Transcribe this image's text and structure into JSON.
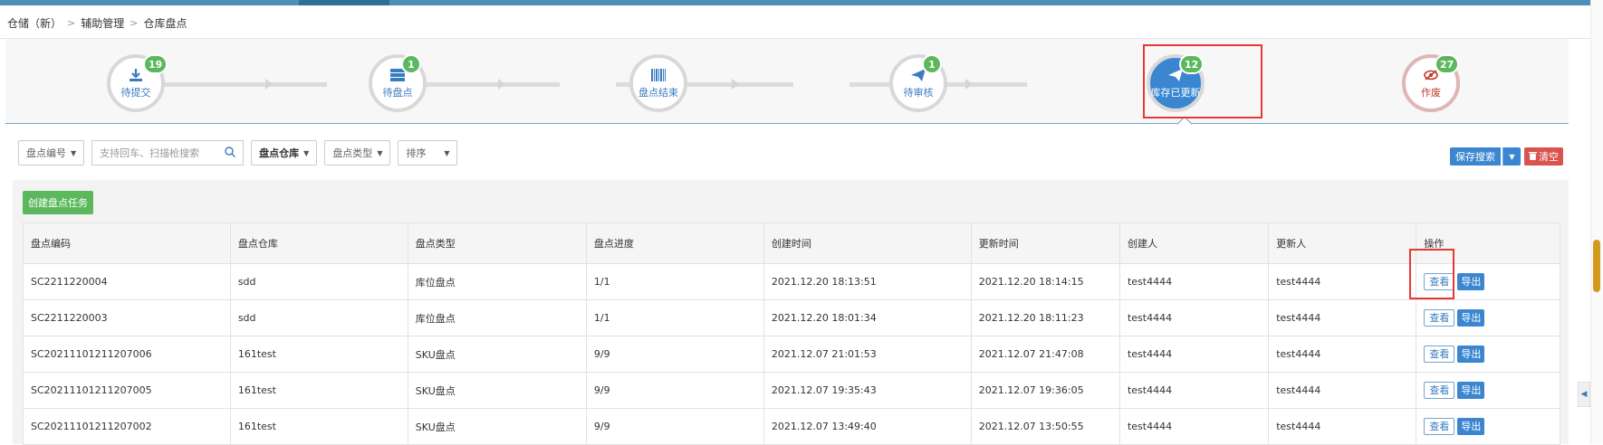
{
  "breadcrumb": [
    "仓储（新）",
    "辅助管理",
    "仓库盘点"
  ],
  "steps": [
    {
      "label": "待提交",
      "count": "19",
      "icon": "download-icon"
    },
    {
      "label": "待盘点",
      "count": "1",
      "icon": "server-icon"
    },
    {
      "label": "盘点结束",
      "count": "",
      "icon": "barcode-icon"
    },
    {
      "label": "待审核",
      "count": "1",
      "icon": "paper-plane-icon"
    },
    {
      "label": "库存已更新",
      "count": "12",
      "icon": "paper-plane-icon",
      "active": true
    },
    {
      "label": "作废",
      "count": "27",
      "icon": "eye-slash-icon"
    }
  ],
  "filters": {
    "code_label": "盘点编号",
    "search_placeholder": "支持回车、扫描枪搜索",
    "warehouse_label": "盘点仓库",
    "type_label": "盘点类型",
    "sort_label": "排序"
  },
  "actions": {
    "save_search": "保存搜索",
    "clear": "清空",
    "create_task": "创建盘点任务"
  },
  "table": {
    "headers": [
      "盘点编码",
      "盘点仓库",
      "盘点类型",
      "盘点进度",
      "创建时间",
      "更新时间",
      "创建人",
      "更新人",
      "操作"
    ],
    "view_label": "查看",
    "export_label": "导出",
    "rows": [
      [
        "SC2211220004",
        "sdd",
        "库位盘点",
        "1/1",
        "2021.12.20 18:13:51",
        "2021.12.20 18:14:15",
        "test4444",
        "test4444"
      ],
      [
        "SC2211220003",
        "sdd",
        "库位盘点",
        "1/1",
        "2021.12.20 18:01:34",
        "2021.12.20 18:11:23",
        "test4444",
        "test4444"
      ],
      [
        "SC20211101211207006",
        "161test",
        "SKU盘点",
        "9/9",
        "2021.12.07 21:01:53",
        "2021.12.07 21:47:08",
        "test4444",
        "test4444"
      ],
      [
        "SC20211101211207005",
        "161test",
        "SKU盘点",
        "9/9",
        "2021.12.07 19:35:43",
        "2021.12.07 19:36:05",
        "test4444",
        "test4444"
      ],
      [
        "SC20211101211207002",
        "161test",
        "SKU盘点",
        "9/9",
        "2021.12.07 13:49:40",
        "2021.12.07 13:50:55",
        "test4444",
        "test4444"
      ]
    ]
  },
  "colors": {
    "primary": "#3a86d0",
    "success": "#5cb85c",
    "danger": "#d9534f",
    "highlight": "#e53935"
  }
}
